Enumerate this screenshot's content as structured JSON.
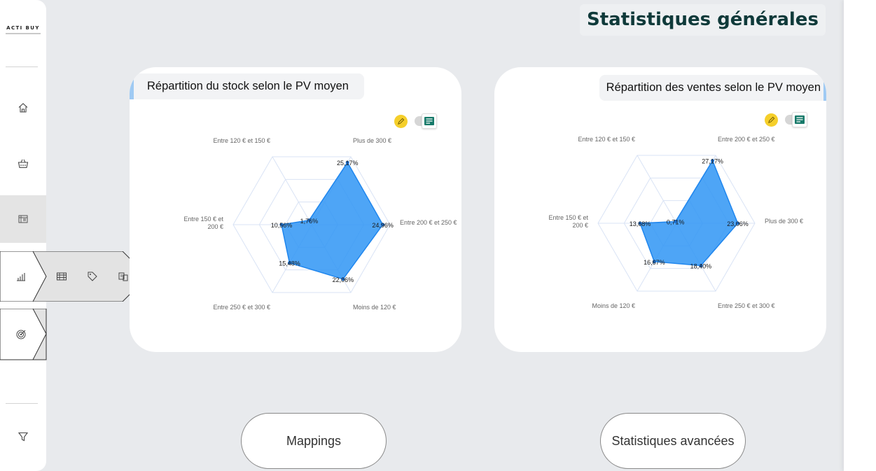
{
  "page": {
    "title": "Statistiques générales"
  },
  "colors": {
    "accent": "#9fcaf3",
    "radar_fill": "#2f95f5",
    "title_text": "#0f3a3a",
    "edit": "#f5cf2a",
    "doc": "#177a6a"
  },
  "sidebar": {
    "logo": "ACTI BUY",
    "items": [
      {
        "icon": "home-icon"
      },
      {
        "icon": "basket-icon"
      },
      {
        "icon": "catalog-icon",
        "active": true
      },
      {
        "icon": "bar-chart-icon"
      },
      {
        "icon": "target-icon"
      },
      {
        "icon": "filter-icon"
      }
    ],
    "flyout_icons": [
      "table-icon",
      "tag-icon",
      "swap-icon"
    ]
  },
  "cards": [
    {
      "title": "Répartition du stock selon le PV moyen",
      "chart_data": {
        "type": "radar",
        "title": "Répartition du stock selon le PV moyen",
        "categories": [
          "Plus de 300 €",
          "Entre 200 € et 250 €",
          "Moins de 120 €",
          "Entre 250 € et 300 €",
          "Entre 150 € et 200 €",
          "Entre 120 € et 150 €"
        ],
        "values": [
          25.17,
          24.96,
          22.06,
          15.48,
          10.56,
          1.76
        ],
        "labels": [
          "25,17%",
          "24,96%",
          "22,06%",
          "15,48%",
          "10,56%",
          "1,76%"
        ],
        "max": 27.5,
        "grid_levels": 3
      }
    },
    {
      "title": "Répartition des ventes selon le PV moyen",
      "chart_data": {
        "type": "radar",
        "title": "Répartition des ventes selon le PV moyen",
        "categories": [
          "Entre 200 € et 250 €",
          "Plus de 300 €",
          "Entre 250 € et 300 €",
          "Moins de 120 €",
          "Entre 150 € et 200 €",
          "Entre 120 € et 150 €"
        ],
        "values": [
          27.17,
          23.06,
          18.4,
          16.67,
          13.68,
          0.71
        ],
        "labels": [
          "27,17%",
          "23,06%",
          "18,40%",
          "16,67%",
          "13,68%",
          "0,71%"
        ],
        "max": 29.5,
        "grid_levels": 3
      }
    }
  ],
  "buttons": {
    "mappings": "Mappings",
    "advanced": "Statistiques avancées"
  }
}
